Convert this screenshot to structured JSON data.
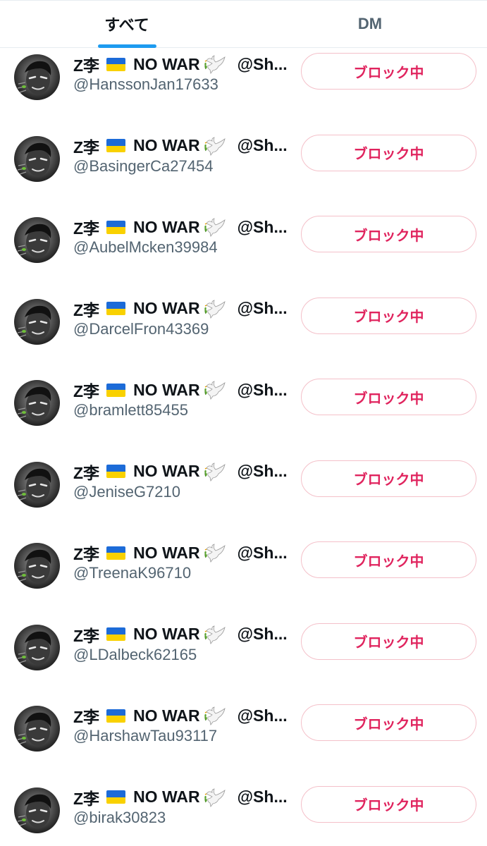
{
  "tabs": [
    {
      "label": "すべて",
      "active": true
    },
    {
      "label": "DM",
      "active": false
    }
  ],
  "colors": {
    "accent": "#1d9bf0",
    "block": "#e0245e",
    "muted": "#536471"
  },
  "display_name": {
    "prefix": "Z李",
    "flag_icon": "ukraine-flag-icon",
    "middle": "NO WAR",
    "dove_icon": "dove-olive-branch-icon",
    "suffix": "@Sh",
    "ellipsis": "..."
  },
  "block_label": "ブロック中",
  "users": [
    {
      "handle": "@HanssonJan17633"
    },
    {
      "handle": "@BasingerCa27454"
    },
    {
      "handle": "@AubelMcken39984"
    },
    {
      "handle": "@DarcelFron43369"
    },
    {
      "handle": "@bramlett85455"
    },
    {
      "handle": "@JeniseG7210"
    },
    {
      "handle": "@TreenaK96710"
    },
    {
      "handle": "@LDalbeck62165"
    },
    {
      "handle": "@HarshawTau93117"
    },
    {
      "handle": "@birak30823"
    }
  ]
}
